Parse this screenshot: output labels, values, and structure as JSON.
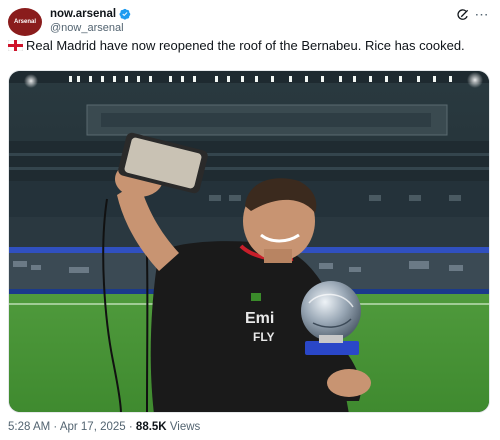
{
  "tweet": {
    "display_name": "now.arsenal",
    "handle": "@now_arsenal",
    "avatar_text": "Arsenal",
    "verified_icon": "verified-badge-icon",
    "text": "Real Madrid have now reopened the roof of the Bernabeu. Rice has cooked.",
    "flag_emoji": "england-flag-emoji",
    "time": "5:28 AM",
    "separator": "·",
    "date": "Apr 17, 2025",
    "views_count": "88.5K",
    "views_label": "Views"
  },
  "media": {
    "description_icon": "photo-image",
    "trophy_plate_text": ""
  },
  "colors": {
    "accent_blue": "#1d9bf0",
    "avatar_red": "#8a1c1c",
    "muted_text": "#536471"
  }
}
